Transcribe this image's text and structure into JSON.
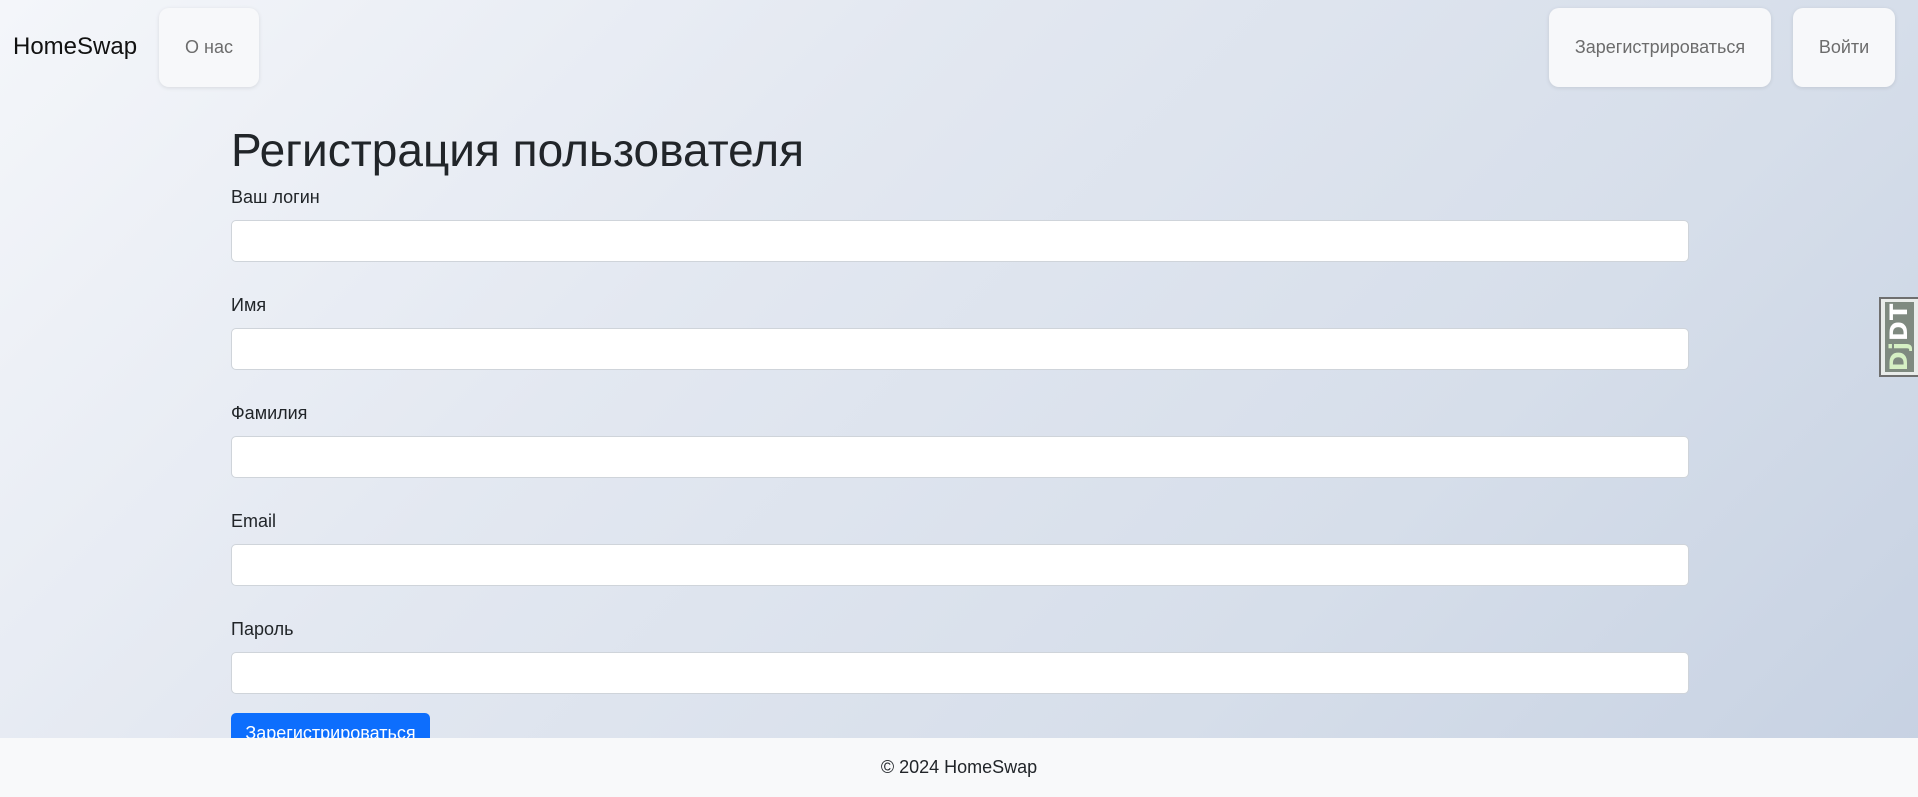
{
  "navbar": {
    "brand": "HomeSwap",
    "about_label": "О нас",
    "register_label": "Зарегистрироваться",
    "login_label": "Войти"
  },
  "form": {
    "title": "Регистрация пользователя",
    "fields": [
      {
        "label": "Ваш логин",
        "value": "",
        "placeholder": ""
      },
      {
        "label": "Имя",
        "value": "",
        "placeholder": ""
      },
      {
        "label": "Фамилия",
        "value": "",
        "placeholder": ""
      },
      {
        "label": "Email",
        "value": "",
        "placeholder": ""
      },
      {
        "label": "Пароль",
        "value": "",
        "placeholder": ""
      }
    ],
    "submit_label": "Зарегистрироваться"
  },
  "footer": {
    "copyright": "© 2024 HomeSwap"
  },
  "debug_toolbar": {
    "handle_text_dj": "Dj",
    "handle_text_dt": "DT",
    "icon": "django-debug-toolbar-icon"
  },
  "colors": {
    "primary": "#0d6efd",
    "footer_bg": "#f8f9fa",
    "nav_pill_bg": "#f7f8fa"
  }
}
